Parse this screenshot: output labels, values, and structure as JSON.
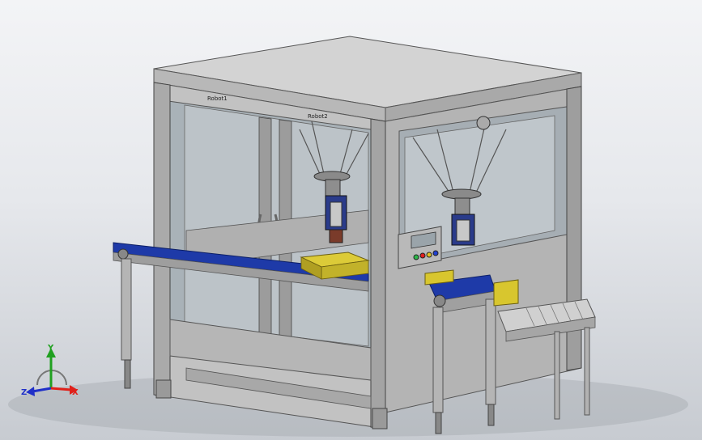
{
  "model": {
    "label_robot1": "Robot1",
    "label_robot2": "Robot2",
    "colors": {
      "frame": "#c4c4c4",
      "frame_dark": "#9a9a9a",
      "top": "#d2d2d2",
      "glass": "#aeb7bd",
      "belt": "#1e3aa8",
      "box": "#d6c12a",
      "background": "#e8eaee"
    },
    "control_panel": {
      "button_colors": [
        "#2db84a",
        "#e02020",
        "#e0c020",
        "#2040d0"
      ]
    }
  },
  "triad": {
    "x_label": "X",
    "y_label": "Y",
    "z_label": "Z",
    "x_color": "#e0201a",
    "y_color": "#20a020",
    "z_color": "#2030c8"
  }
}
